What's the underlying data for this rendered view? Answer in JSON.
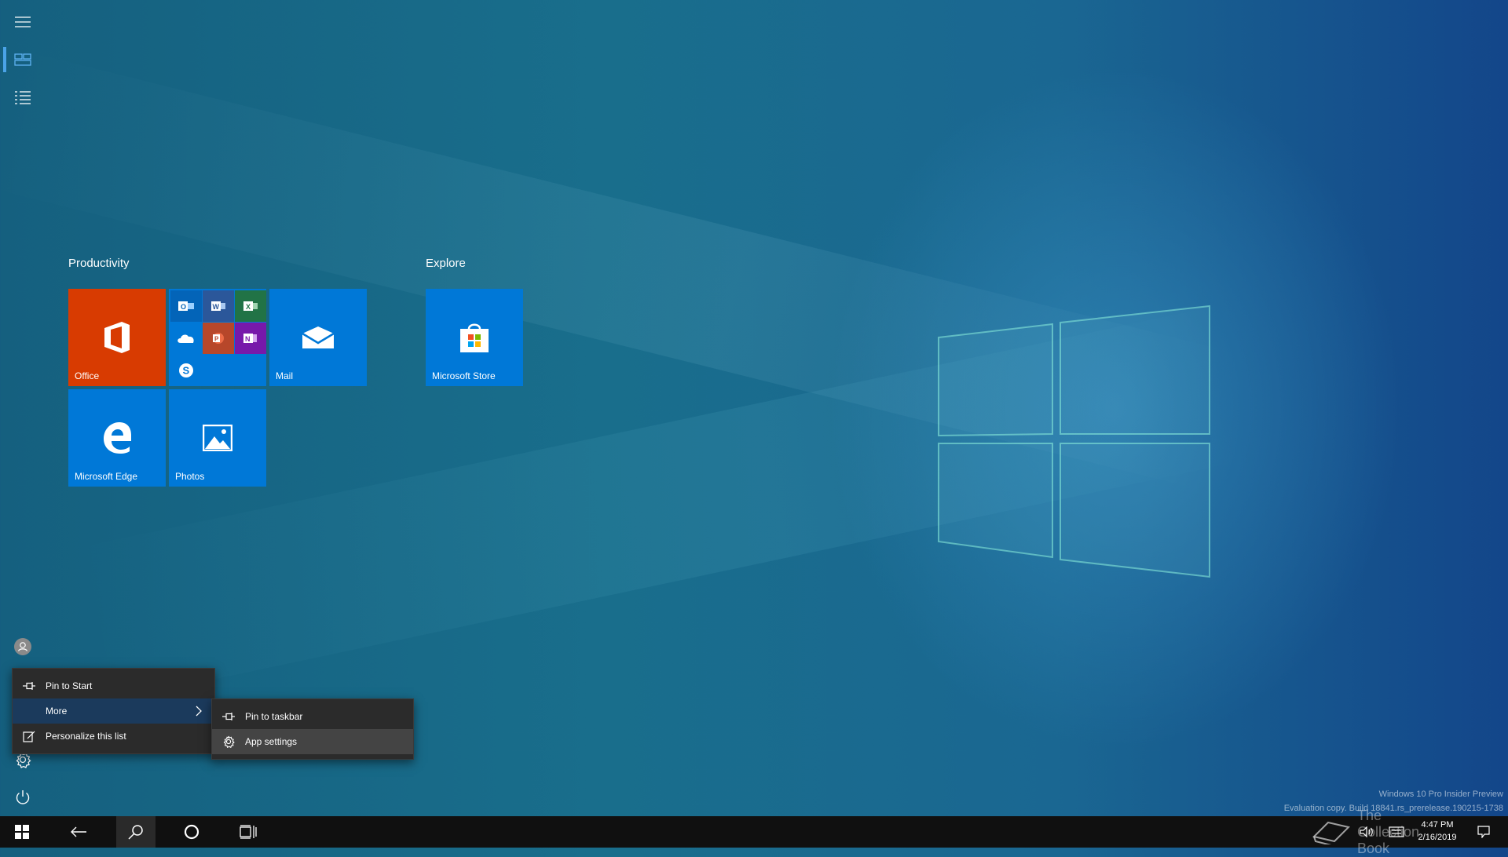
{
  "start": {
    "groups": [
      {
        "title": "Productivity",
        "tiles": [
          {
            "label": "Office",
            "color": "#d83b01"
          },
          {
            "label": "",
            "color": "#0078d7",
            "apps": [
              "Outlook",
              "Word",
              "Excel",
              "OneDrive",
              "PowerPoint",
              "OneNote",
              "Skype"
            ]
          },
          {
            "label": "Mail",
            "color": "#0078d7"
          },
          {
            "label": "Microsoft Edge",
            "color": "#0078d7"
          },
          {
            "label": "Photos",
            "color": "#0078d7"
          }
        ]
      },
      {
        "title": "Explore",
        "tiles": [
          {
            "label": "Microsoft Store",
            "color": "#0078d7"
          }
        ]
      }
    ]
  },
  "context_menu": {
    "items": [
      {
        "label": "Pin to Start",
        "icon": "pin-icon"
      },
      {
        "label": "More",
        "icon": "",
        "has_submenu": true
      },
      {
        "label": "Personalize this list",
        "icon": "edit-list-icon"
      }
    ]
  },
  "submenu": {
    "items": [
      {
        "label": "Pin to taskbar",
        "icon": "pin-icon"
      },
      {
        "label": "App settings",
        "icon": "gear-icon"
      }
    ]
  },
  "taskbar": {
    "clock_time": "4:47 PM",
    "clock_date": "2/16/2019"
  },
  "watermark": {
    "line1": "Windows 10 Pro Insider Preview",
    "line2": "Evaluation copy. Build 18841.rs_prerelease.190215-1738"
  },
  "overlay_logo_text": "The Collection Book",
  "colors": {
    "accent": "#0078d7",
    "office": "#d83b01",
    "menu_bg": "#2b2b2b",
    "taskbar": "#101010"
  }
}
